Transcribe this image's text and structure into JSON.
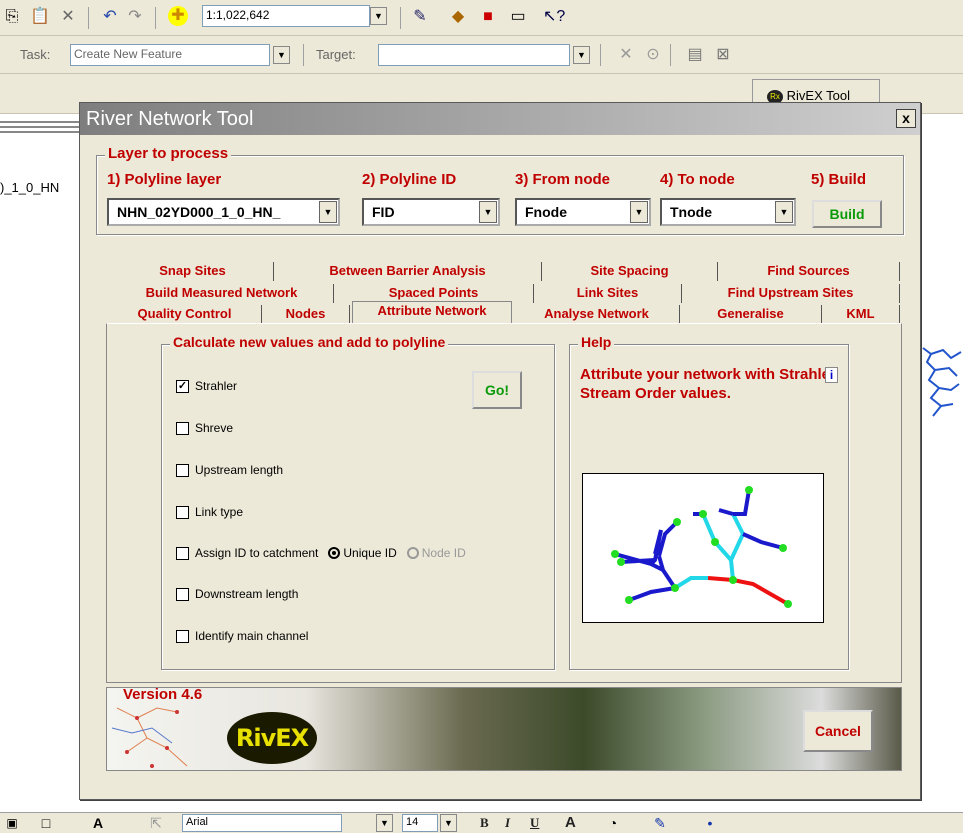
{
  "background": {
    "scale_value": "1:1,022,642",
    "task_label": "Task:",
    "task_value": "Create New Feature",
    "target_label": "Target:",
    "rivex_tool_button": "RivEX Tool",
    "map_layer_label": ")_1_0_HN",
    "font_name": "Arial",
    "font_size": "14",
    "bold_label": "B",
    "italic_label": "I",
    "underline_label": "U",
    "font_color_label": "A"
  },
  "dialog": {
    "title": "River Network Tool",
    "close_label": "x",
    "layer_group": {
      "label": "Layer to process",
      "headings": [
        "1) Polyline layer",
        "2) Polyline ID",
        "3) From node",
        "4) To node",
        "5) Build"
      ],
      "polyline_layer": "NHN_02YD000_1_0_HN_",
      "polyline_id": "FID",
      "from_node": "Fnode",
      "to_node": "Tnode",
      "build_button": "Build"
    },
    "tabs": {
      "row1": [
        "Snap Sites",
        "Between Barrier Analysis",
        "Site Spacing",
        "Find Sources"
      ],
      "row2": [
        "Build Measured Network",
        "Spaced Points",
        "Link Sites",
        "Find Upstream Sites"
      ],
      "row3": [
        "Quality Control",
        "Nodes",
        "Attribute Network",
        "Analyse Network",
        "Generalise",
        "KML"
      ],
      "active": "Attribute Network"
    },
    "calc_group": {
      "label": "Calculate new values and add to polyline",
      "go_button": "Go!",
      "options": [
        {
          "label": "Strahler",
          "checked": true
        },
        {
          "label": "Shreve",
          "checked": false
        },
        {
          "label": "Upstream length",
          "checked": false
        },
        {
          "label": "Link type",
          "checked": false
        },
        {
          "label": "Assign ID to catchment",
          "checked": false
        },
        {
          "label": "Downstream length",
          "checked": false
        },
        {
          "label": "Identify main channel",
          "checked": false
        }
      ],
      "radio_unique": "Unique ID",
      "radio_node": "Node ID"
    },
    "help_group": {
      "label": "Help",
      "text": "Attribute your network with Strahler Stream Order values.",
      "info_button": "i"
    },
    "banner": {
      "version": "Version 4.6",
      "logo_text": "RivEX",
      "cancel_button": "Cancel"
    }
  },
  "colors": {
    "accent_red": "#c00000",
    "button_green": "#0a9a0a",
    "stream_order_1": "#1a1acc",
    "stream_order_2": "#22d8e8",
    "stream_order_3": "#ee1111",
    "node_green": "#22dd22"
  }
}
